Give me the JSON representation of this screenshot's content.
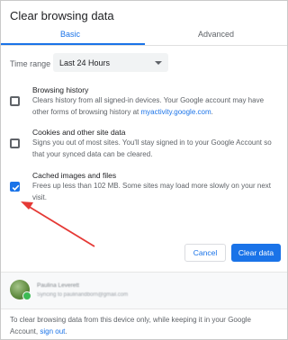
{
  "dialog": {
    "title": "Clear browsing data"
  },
  "tabs": [
    {
      "label": "Basic",
      "active": true
    },
    {
      "label": "Advanced",
      "active": false
    }
  ],
  "time_range": {
    "label": "Time range",
    "value": "Last 24 Hours"
  },
  "options": [
    {
      "title": "Browsing history",
      "desc_before": "Clears history from all signed-in devices. Your Google account may have other forms of browsing history at ",
      "link": "myactivity.google.com",
      "desc_after": ".",
      "checked": false
    },
    {
      "title": "Cookies and other site data",
      "desc_before": "Signs you out of most sites. You'll stay signed in to your Google Account so that your synced data can be cleared.",
      "link": "",
      "desc_after": "",
      "checked": false
    },
    {
      "title": "Cached images and files",
      "desc_before": "Frees up less than 102 MB. Some sites may load more slowly on your next visit.",
      "link": "",
      "desc_after": "",
      "checked": true
    }
  ],
  "buttons": {
    "cancel": "Cancel",
    "clear": "Clear data"
  },
  "account": {
    "name": "Paulina Leverett",
    "sync": "Syncing to paulinaridborn@gmail.com"
  },
  "footer": {
    "text": "To clear browsing data from this device only, while keeping it in your Google Account, ",
    "link": "sign out",
    "end": "."
  },
  "colors": {
    "accent": "#1a73e8",
    "annotation_arrow": "#e53935"
  }
}
